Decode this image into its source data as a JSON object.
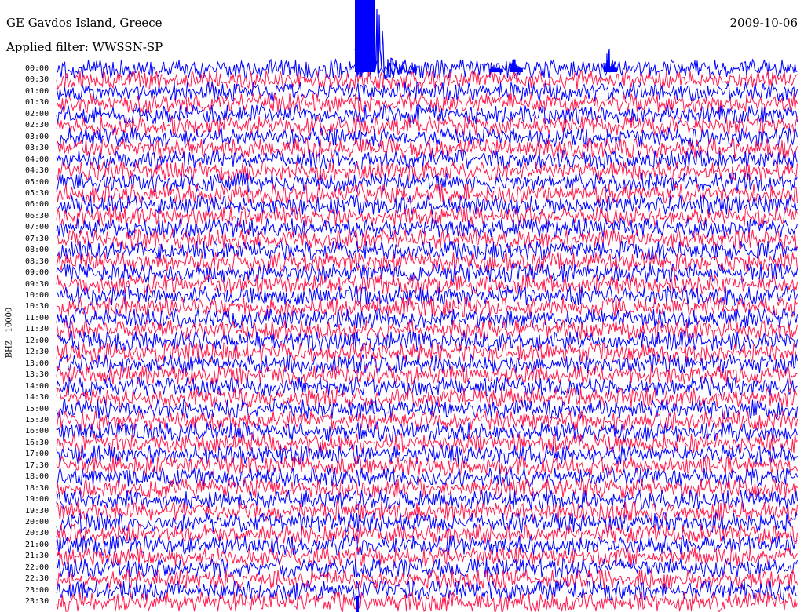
{
  "header": {
    "station": "GE Gavdos Island, Greece",
    "filter": "Applied filter: WWSSN-SP",
    "date": "2009-10-06"
  },
  "chart_data": {
    "type": "line",
    "title": "GE Gavdos Island, Greece",
    "date": "2009-10-06",
    "filter": "Applied filter: WWSSN-SP",
    "ylabel": "BHZ - 10000",
    "row_interval_minutes": 30,
    "time_labels": [
      "00:00",
      "00:30",
      "01:00",
      "01:30",
      "02:00",
      "02:30",
      "03:00",
      "03:30",
      "04:00",
      "04:30",
      "05:00",
      "05:30",
      "06:00",
      "06:30",
      "07:00",
      "07:30",
      "08:00",
      "08:30",
      "09:00",
      "09:30",
      "10:00",
      "10:30",
      "11:00",
      "11:30",
      "12:00",
      "12:30",
      "13:00",
      "13:30",
      "14:00",
      "14:30",
      "15:00",
      "15:30",
      "16:00",
      "16:30",
      "17:00",
      "17:30",
      "18:00",
      "18:30",
      "19:00",
      "19:30",
      "20:00",
      "20:30",
      "21:00",
      "21:30",
      "22:00",
      "22:30",
      "23:00",
      "23:30"
    ],
    "series_colors": [
      "#0000ff",
      "#ff1a4d"
    ],
    "colors": {
      "blue": "#0000ff",
      "red": "#ff1a4d",
      "background": "#ffffff"
    }
  }
}
